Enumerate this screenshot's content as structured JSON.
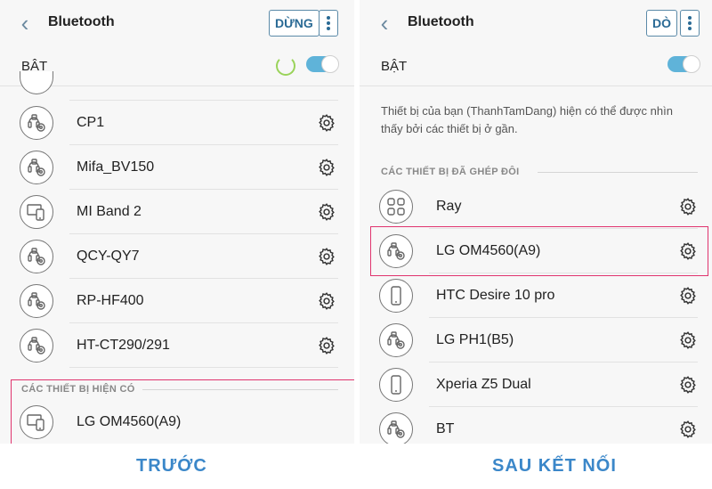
{
  "left": {
    "header": {
      "title": "Bluetooth",
      "stop_label": "DỪNG"
    },
    "status_label": "BẬT",
    "paired_devices": [
      {
        "name": "CP1",
        "icon": "headset-icon"
      },
      {
        "name": "Mifa_BV150",
        "icon": "headset-icon"
      },
      {
        "name": "MI Band 2",
        "icon": "devices-icon"
      },
      {
        "name": "QCY-QY7",
        "icon": "headset-icon"
      },
      {
        "name": "RP-HF400",
        "icon": "headset-icon"
      },
      {
        "name": "HT-CT290/291",
        "icon": "headset-icon"
      }
    ],
    "available_section": "CÁC THIẾT BỊ HIỆN CÓ",
    "available_devices": [
      {
        "name": "LG OM4560(A9)",
        "icon": "devices-icon"
      }
    ],
    "caption": "TRƯỚC"
  },
  "right": {
    "header": {
      "title": "Bluetooth",
      "stop_label": "DÒ"
    },
    "status_label": "BẬT",
    "info_text": "Thiết bị của bạn (ThanhTamDang) hiện có thể được nhìn thấy bởi các thiết bị ở gần.",
    "paired_section": "CÁC THIẾT BỊ ĐÃ GHÉP ĐÔI",
    "paired_devices": [
      {
        "name": "Ray",
        "icon": "grid-icon"
      },
      {
        "name": "LG OM4560(A9)",
        "icon": "headset-icon"
      },
      {
        "name": "HTC Desire 10 pro",
        "icon": "phone-icon"
      },
      {
        "name": "LG PH1(B5)",
        "icon": "headset-icon"
      },
      {
        "name": "Xperia Z5 Dual",
        "icon": "phone-icon"
      },
      {
        "name": "BT",
        "icon": "headset-icon"
      }
    ],
    "caption": "SAU KẾT NỐI"
  },
  "colors": {
    "accent": "#3b87c9",
    "toggle": "#5fb3d9",
    "highlight": "#e0346e"
  }
}
